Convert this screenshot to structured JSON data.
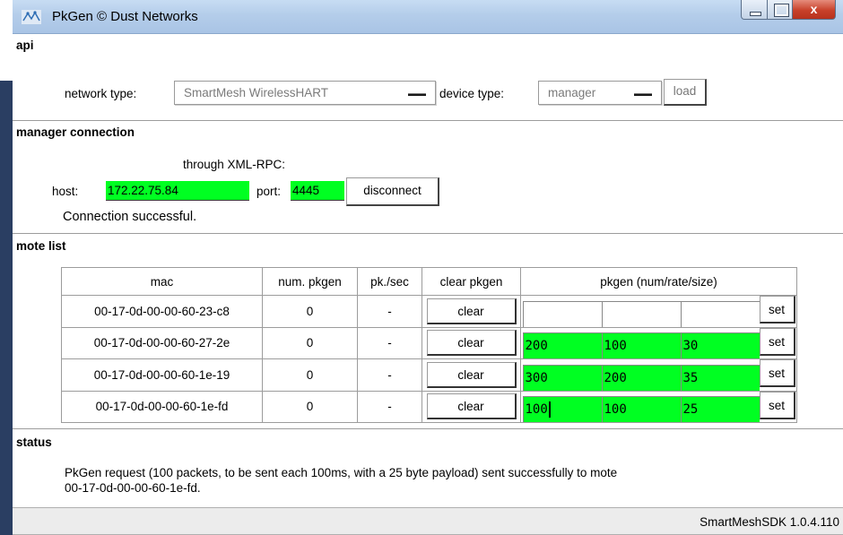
{
  "window": {
    "title": "PkGen © Dust Networks",
    "close_label": "x"
  },
  "api": {
    "section_title": "api",
    "network_type_label": "network type:",
    "network_type_value": "SmartMesh WirelessHART",
    "device_type_label": "device type:",
    "device_type_value": "manager",
    "load_label": "load"
  },
  "manager_connection": {
    "section_title": "manager connection",
    "method_label": "through XML-RPC:",
    "host_label": "host:",
    "host_value": "172.22.75.84",
    "port_label": "port:",
    "port_value": "4445",
    "disconnect_label": "disconnect",
    "status_text": "Connection successful."
  },
  "mote_list": {
    "section_title": "mote list",
    "columns": [
      "mac",
      "num. pkgen",
      "pk./sec",
      "clear pkgen",
      "pkgen (num/rate/size)"
    ],
    "clear_label": "clear",
    "set_label": "set",
    "rows": [
      {
        "mac": "00-17-0d-00-00-60-23-c8",
        "num_pkgen": "0",
        "pk_sec": "-",
        "num": "",
        "rate": "",
        "size": ""
      },
      {
        "mac": "00-17-0d-00-00-60-27-2e",
        "num_pkgen": "0",
        "pk_sec": "-",
        "num": "200",
        "rate": "100",
        "size": "30"
      },
      {
        "mac": "00-17-0d-00-00-60-1e-19",
        "num_pkgen": "0",
        "pk_sec": "-",
        "num": "300",
        "rate": "200",
        "size": "35"
      },
      {
        "mac": "00-17-0d-00-00-60-1e-fd",
        "num_pkgen": "0",
        "pk_sec": "-",
        "num": "100",
        "rate": "100",
        "size": "25"
      }
    ]
  },
  "status": {
    "section_title": "status",
    "message_line1": "PkGen request (100 packets, to be sent each 100ms, with a 25 byte payload) sent successfully to mote",
    "message_line2": "00-17-0d-00-00-60-1e-fd."
  },
  "footer": {
    "version": "SmartMeshSDK 1.0.4.110"
  },
  "colors": {
    "field_green": "#00ff22",
    "titlebar": "#b4cdea",
    "close_red": "#c8412a"
  }
}
